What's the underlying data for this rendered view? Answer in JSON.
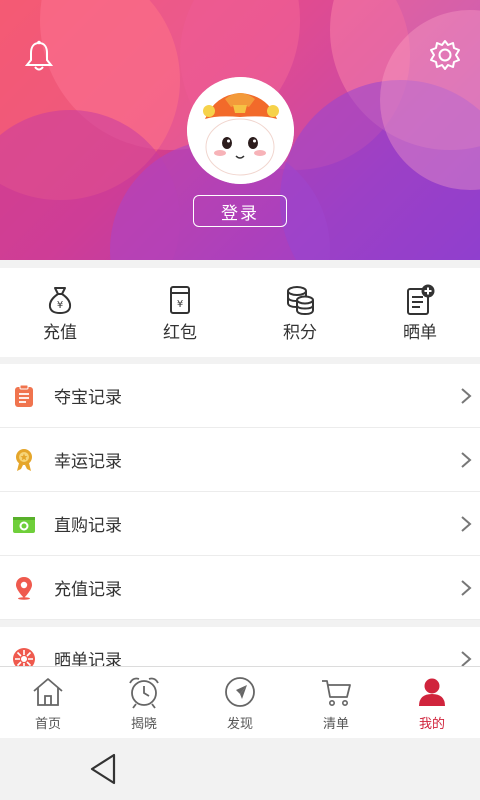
{
  "header": {
    "login_label": "登录",
    "icons": {
      "left": "bell-icon",
      "right": "gear-icon"
    }
  },
  "quick_actions": [
    {
      "label": "充值",
      "icon": "money-bag-icon"
    },
    {
      "label": "红包",
      "icon": "red-envelope-icon"
    },
    {
      "label": "积分",
      "icon": "coins-stack-icon"
    },
    {
      "label": "晒单",
      "icon": "document-add-icon"
    }
  ],
  "records": [
    {
      "label": "夺宝记录",
      "icon": "clipboard-icon",
      "color": "#f0744e"
    },
    {
      "label": "幸运记录",
      "icon": "medal-icon",
      "color": "#e5a62b"
    },
    {
      "label": "直购记录",
      "icon": "camera-icon",
      "color": "#6fcf3a"
    },
    {
      "label": "充值记录",
      "icon": "location-pin-icon",
      "color": "#ef5a4e"
    },
    {
      "label": "晒单记录",
      "icon": "flower-icon",
      "color": "#ef5a4e"
    }
  ],
  "tabbar": {
    "tabs": [
      {
        "label": "首页",
        "icon": "home-icon"
      },
      {
        "label": "揭晓",
        "icon": "alarm-clock-icon"
      },
      {
        "label": "发现",
        "icon": "compass-icon"
      },
      {
        "label": "清单",
        "icon": "cart-icon"
      },
      {
        "label": "我的",
        "icon": "user-icon"
      }
    ],
    "active_color": "#d0243c"
  }
}
